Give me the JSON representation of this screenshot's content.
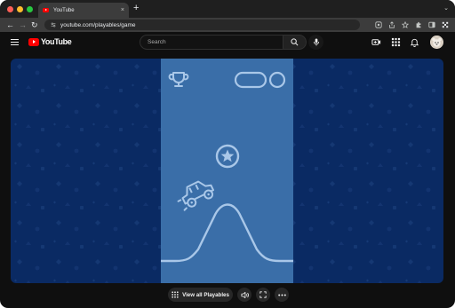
{
  "browser": {
    "tab": {
      "title": "YouTube",
      "close_glyph": "×"
    },
    "new_tab_glyph": "+",
    "tab_search_glyph": "⌄",
    "nav": {
      "back_glyph": "←",
      "forward_glyph": "→",
      "reload_glyph": "↻"
    },
    "url": "youtube.com/playables/game",
    "toolbar_icons": [
      "google-lens-icon",
      "share-icon",
      "bookmark-star-icon",
      "extensions-icon",
      "side-panel-icon",
      "profile-icon"
    ]
  },
  "youtube_header": {
    "logo_text": "YouTube",
    "search_placeholder": "Search",
    "icons": [
      "menu-icon",
      "search-icon",
      "microphone-icon",
      "create-icon",
      "apps-icon",
      "notifications-bell-icon",
      "avatar"
    ],
    "colors": {
      "brand_red": "#ff0000",
      "background": "#0f0f0f"
    }
  },
  "game": {
    "background_color": "#0a2a63",
    "playfield_color": "#3a6ea8",
    "icons": [
      "trophy-icon",
      "pill-button-icon",
      "circle-button-icon",
      "star-coin-icon",
      "car-icon",
      "hill-track"
    ]
  },
  "controls": {
    "view_all_playables_label": "View all Playables",
    "more_glyph": "⋯",
    "icons": [
      "grid-icon",
      "audio-icon",
      "fullscreen-icon",
      "more-options-icon"
    ]
  }
}
